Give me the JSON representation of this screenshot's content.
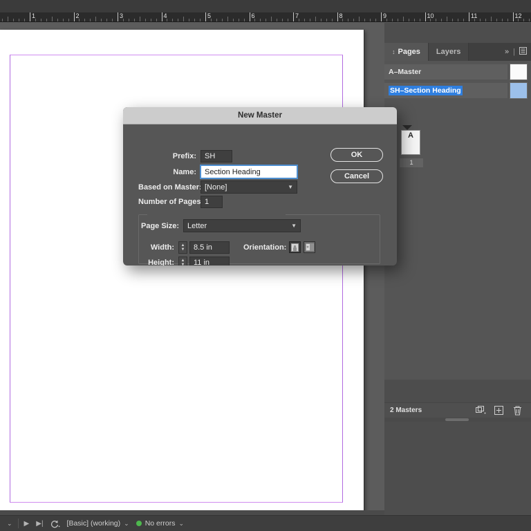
{
  "ruler": {
    "unit": "in",
    "labels": [
      "1",
      "2",
      "3",
      "4",
      "5",
      "6",
      "7",
      "8",
      "9",
      "10",
      "11",
      "12"
    ]
  },
  "dialog": {
    "title": "New Master",
    "fields": {
      "prefix_label": "Prefix:",
      "prefix_value": "SH",
      "name_label": "Name:",
      "name_value": "Section Heading",
      "based_on_label": "Based on Master:",
      "based_on_value": "[None]",
      "pages_label": "Number of Pages:",
      "pages_value": "1"
    },
    "page_size": {
      "label": "Page Size:",
      "value": "Letter",
      "width_label": "Width:",
      "width_value": "8.5 in",
      "height_label": "Height:",
      "height_value": "11 in",
      "orientation_label": "Orientation:",
      "orientation_selected": "portrait"
    },
    "buttons": {
      "ok": "OK",
      "cancel": "Cancel"
    }
  },
  "panel": {
    "tabs": [
      {
        "label": "Pages",
        "active": true
      },
      {
        "label": "Layers",
        "active": false
      }
    ],
    "collapse_icon": "»",
    "menu_icon": "≡",
    "masters": [
      {
        "name": "A–Master",
        "selected": false,
        "swatch": "white"
      },
      {
        "name": "SH–Section Heading",
        "selected": true,
        "swatch": "blue"
      }
    ],
    "page_thumb_label": "A",
    "page_number": "1",
    "footer_count": "2 Masters",
    "footer_icons": [
      "new-master-icon",
      "new-page-icon",
      "delete-icon"
    ]
  },
  "statusbar": {
    "nav_first_icon": "◀",
    "nav_prev_icon": "▸",
    "nav_next_icon": "▸|",
    "preflight_profile": "[Basic] (working)",
    "errors": "No errors",
    "error_dot_color": "#4eb84e",
    "caret": "⌄"
  },
  "colors": {
    "dialog_body": "#565656",
    "dialog_title_bar": "#cccccc",
    "selection_blue": "#2f7fe0",
    "margin_guide": "#d08cf0",
    "panel_bg": "#555555",
    "pasteboard": "#5c5c5c"
  }
}
